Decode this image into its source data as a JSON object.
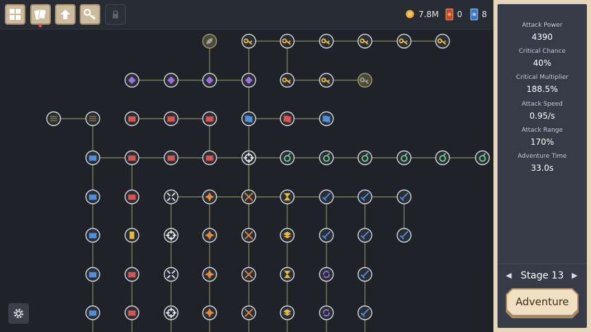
{
  "top_bar": {
    "buttons": [
      {
        "name": "grid-menu-button",
        "icon": "grid-icon"
      },
      {
        "name": "cards-button",
        "icon": "cards-icon",
        "notification": true
      },
      {
        "name": "upgrade-button",
        "icon": "up-arrow-icon"
      },
      {
        "name": "keys-button",
        "icon": "key-icon"
      },
      {
        "name": "locked-button",
        "icon": "lock-icon",
        "locked": true
      }
    ],
    "resources": {
      "coins": "7.8M",
      "red_cards": "0",
      "blue_cards": "8"
    }
  },
  "colors": {
    "background": "#1f2329",
    "topbar": "#272b33",
    "panel_frame": "#e5d6b9",
    "panel": "#353b47",
    "gold": "#e7b93f",
    "red": "#d9544f",
    "blue": "#4f8fe0",
    "purple": "#9b6fdc",
    "green": "#6fc98a",
    "orange": "#e58a3c",
    "line": "#8e8a5e"
  },
  "stats": [
    {
      "label": "Attack Power",
      "value": "4390"
    },
    {
      "label": "Critical Chance",
      "value": "40%"
    },
    {
      "label": "Critical Multiplier",
      "value": "188.5%"
    },
    {
      "label": "Attack Speed",
      "value": "0.95/s"
    },
    {
      "label": "Attack Range",
      "value": "170%"
    },
    {
      "label": "Adventure Time",
      "value": "33.0s"
    }
  ],
  "stage": {
    "label": "Stage 13"
  },
  "adventure_button": {
    "label": "Adventure"
  },
  "settings": {
    "icon": "gear-icon"
  }
}
